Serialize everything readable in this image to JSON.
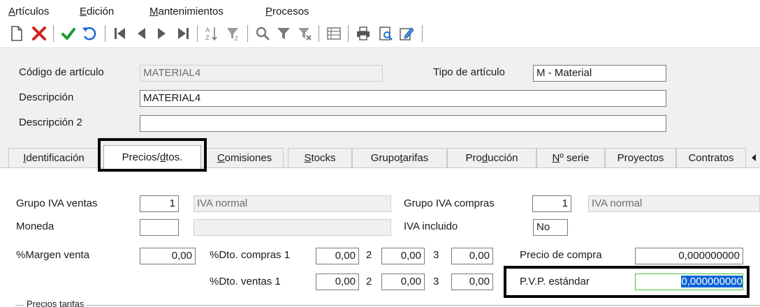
{
  "menu": {
    "articulos": {
      "first": "A",
      "rest": "rtículos"
    },
    "edicion": {
      "first": "E",
      "rest": "dición"
    },
    "mantenimientos": {
      "first": "M",
      "rest": "antenimientos"
    },
    "procesos": {
      "first": "P",
      "rest": "rocesos"
    }
  },
  "toolbar": {
    "icons": [
      "new-document",
      "delete",
      "confirm",
      "undo",
      "first-record",
      "previous-record",
      "next-record",
      "last-record",
      "sort-az",
      "filter-sort",
      "search",
      "filter",
      "clear-filter",
      "list-view",
      "print",
      "print-preview",
      "edit-document"
    ],
    "colors": {
      "delete": "#d42020",
      "confirm": "#1c9a2c",
      "undo": "#1c6fd0",
      "nav": "#5a5a5a"
    }
  },
  "header": {
    "codigo_label": "Código de artículo",
    "codigo_value": "MATERIAL4",
    "tipo_label": "Tipo de artículo",
    "tipo_value": "M  - Material",
    "descripcion_label": "Descripción",
    "descripcion_value": "MATERIAL4",
    "descripcion2_label": "Descripción 2",
    "descripcion2_value": ""
  },
  "tabs": [
    {
      "pre": "",
      "u": "I",
      "post": "dentificación"
    },
    {
      "pre": "Precios/",
      "u": "d",
      "post": "tos."
    },
    {
      "pre": "",
      "u": "C",
      "post": "omisiones"
    },
    {
      "pre": "",
      "u": "S",
      "post": "tocks"
    },
    {
      "pre": "Grupo ",
      "u": "t",
      "post": "arifas"
    },
    {
      "pre": "Pro",
      "u": "d",
      "post": "ucción"
    },
    {
      "pre": "",
      "u": "N",
      "post": "º serie"
    },
    {
      "pre": "Proyectos",
      "u": "",
      "post": ""
    },
    {
      "pre": "Contratos",
      "u": "",
      "post": ""
    }
  ],
  "active_tab": 1,
  "precios": {
    "grupo_iva_ventas_label": "Grupo IVA ventas",
    "grupo_iva_ventas_code": "1",
    "grupo_iva_ventas_desc": "IVA normal",
    "grupo_iva_compras_label": "Grupo IVA compras",
    "grupo_iva_compras_code": "1",
    "grupo_iva_compras_desc": "IVA normal",
    "moneda_label": "Moneda",
    "moneda_code": "",
    "moneda_desc": "",
    "iva_incluido_label": "IVA incluido",
    "iva_incluido_value": "No",
    "margen_label": "%Margen venta",
    "margen_value": "0,00",
    "dto_compras_label": "%Dto. compras 1",
    "dto_compras_1": "0,00",
    "dto_compras_2_label": "2",
    "dto_compras_2": "0,00",
    "dto_compras_3_label": "3",
    "dto_compras_3": "0,00",
    "precio_compra_label": "Precio de compra",
    "precio_compra_value": "0,000000000",
    "dto_ventas_label": "%Dto. ventas  1",
    "dto_ventas_1": "0,00",
    "dto_ventas_2_label": "2",
    "dto_ventas_2": "0,00",
    "dto_ventas_3_label": "3",
    "dto_ventas_3": "0,00",
    "pvp_label": "P.V.P. estándar",
    "pvp_value": "0,000000000",
    "precios_tarifas_label": "Precios tarifas"
  }
}
